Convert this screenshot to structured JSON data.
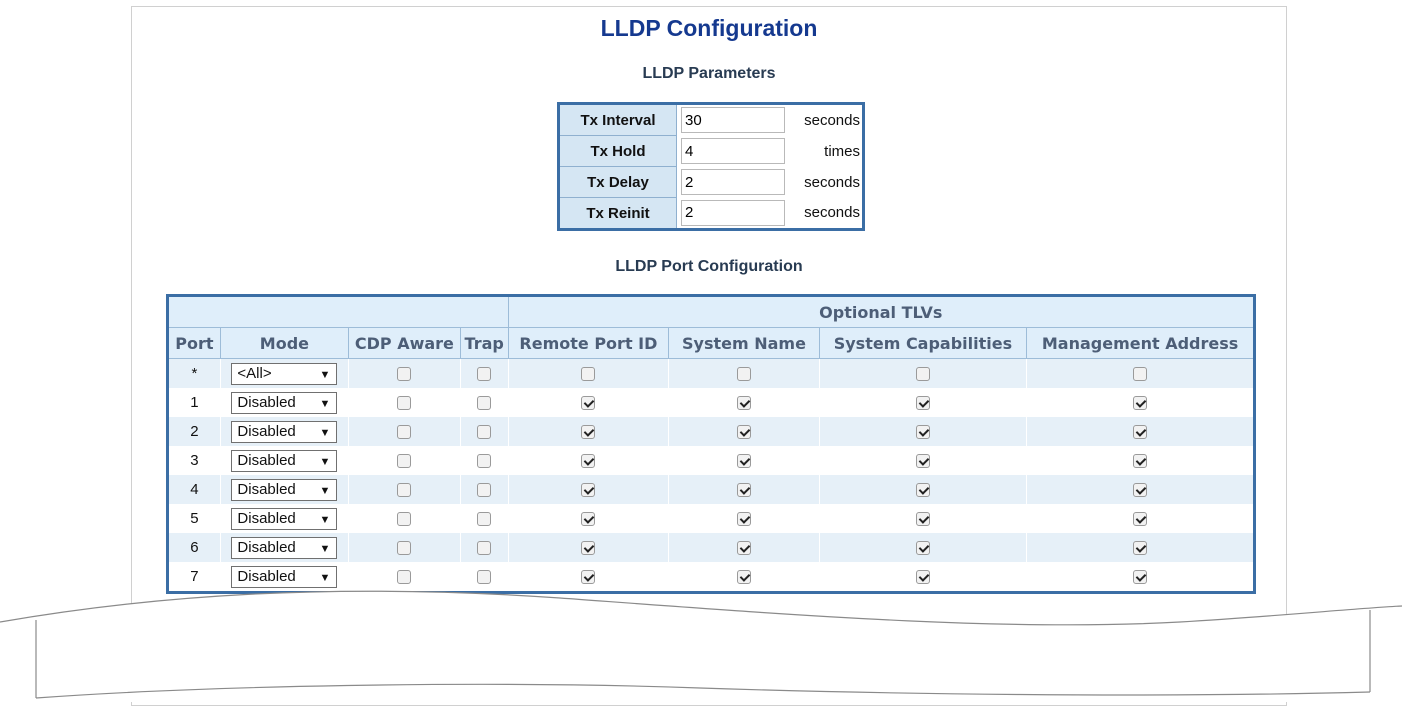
{
  "page": {
    "title": "LLDP Configuration",
    "parameters_title": "LLDP Parameters",
    "port_config_title": "LLDP Port Configuration"
  },
  "parameters": [
    {
      "label": "Tx Interval",
      "value": "30",
      "unit": "seconds"
    },
    {
      "label": "Tx Hold",
      "value": "4",
      "unit": "times"
    },
    {
      "label": "Tx Delay",
      "value": "2",
      "unit": "seconds"
    },
    {
      "label": "Tx Reinit",
      "value": "2",
      "unit": "seconds"
    }
  ],
  "ports": {
    "group_header": "Optional TLVs",
    "columns": [
      "Port",
      "Mode",
      "CDP Aware",
      "Trap",
      "Remote Port ID",
      "System Name",
      "System Capabilities",
      "Management Address"
    ],
    "rows": [
      {
        "port": "*",
        "mode": "<All>",
        "cdp_aware": false,
        "trap": false,
        "remote_port_id": false,
        "system_name": false,
        "system_capabilities": false,
        "management_address": false
      },
      {
        "port": "1",
        "mode": "Disabled",
        "cdp_aware": false,
        "trap": false,
        "remote_port_id": true,
        "system_name": true,
        "system_capabilities": true,
        "management_address": true
      },
      {
        "port": "2",
        "mode": "Disabled",
        "cdp_aware": false,
        "trap": false,
        "remote_port_id": true,
        "system_name": true,
        "system_capabilities": true,
        "management_address": true
      },
      {
        "port": "3",
        "mode": "Disabled",
        "cdp_aware": false,
        "trap": false,
        "remote_port_id": true,
        "system_name": true,
        "system_capabilities": true,
        "management_address": true
      },
      {
        "port": "4",
        "mode": "Disabled",
        "cdp_aware": false,
        "trap": false,
        "remote_port_id": true,
        "system_name": true,
        "system_capabilities": true,
        "management_address": true
      },
      {
        "port": "5",
        "mode": "Disabled",
        "cdp_aware": false,
        "trap": false,
        "remote_port_id": true,
        "system_name": true,
        "system_capabilities": true,
        "management_address": true
      },
      {
        "port": "6",
        "mode": "Disabled",
        "cdp_aware": false,
        "trap": false,
        "remote_port_id": true,
        "system_name": true,
        "system_capabilities": true,
        "management_address": true
      },
      {
        "port": "7",
        "mode": "Disabled",
        "cdp_aware": false,
        "trap": false,
        "remote_port_id": true,
        "system_name": true,
        "system_capabilities": true,
        "management_address": true
      }
    ]
  },
  "colors": {
    "title": "#15398f",
    "table_border": "#3b6ea5",
    "header_bg": "#dfeefa",
    "even_row_bg": "#e6f0f8"
  }
}
